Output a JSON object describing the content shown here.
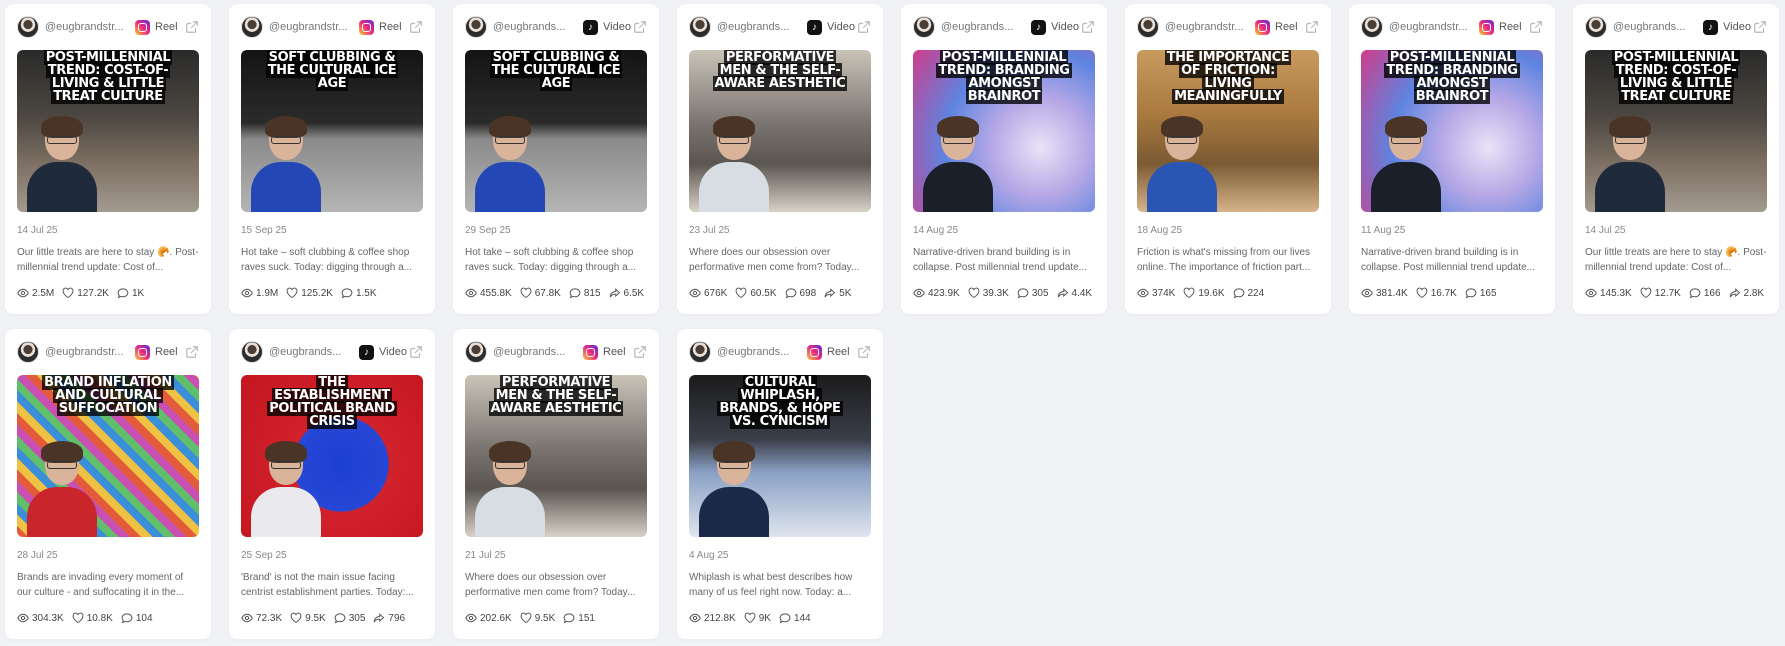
{
  "posts": [
    {
      "handle": "@eugbrandstr...",
      "platform": "instagram",
      "platform_label": "Reel",
      "title": "Post-Millennial Trend: Cost-of-Living & Little Treat Culture",
      "date": "14 Jul 25",
      "caption": "Our little treats are here to stay 🥐. Post-millennial trend update: Cost of...",
      "views": "2.5M",
      "likes": "127.2K",
      "comments": "1K",
      "shares": "",
      "bg": "linear-gradient(180deg,#2a2a2a 0%,#4b4640 40%,#7d6f63 70%,#a39a90 100%)",
      "shirt": "#1f2a3b"
    },
    {
      "handle": "@eugbrandstr...",
      "platform": "instagram",
      "platform_label": "Reel",
      "title": "Soft Clubbing & The Cultural Ice Age",
      "date": "15 Sep 25",
      "caption": "Hot take – soft clubbing & coffee shop raves suck. Today: digging through a...",
      "views": "1.9M",
      "likes": "125.2K",
      "comments": "1.5K",
      "shares": "",
      "bg": "linear-gradient(180deg,#141414 0%,#2b2b2b 45%,#8a8a8a 55%,#b5b5b5 100%)",
      "shirt": "#2447b8"
    },
    {
      "handle": "@eugbrands...",
      "platform": "tiktok",
      "platform_label": "Video",
      "title": "Soft Clubbing & The Cultural Ice Age",
      "date": "29 Sep 25",
      "caption": "Hot take – soft clubbing & coffee shop raves suck. Today: digging through a...",
      "views": "455.8K",
      "likes": "67.8K",
      "comments": "815",
      "shares": "6.5K",
      "bg": "linear-gradient(180deg,#141414 0%,#2b2b2b 45%,#8a8a8a 55%,#b5b5b5 100%)",
      "shirt": "#2447b8"
    },
    {
      "handle": "@eugbrands...",
      "platform": "tiktok",
      "platform_label": "Video",
      "title": "Performative Men & The Self-Aware Aesthetic",
      "date": "23 Jul 25",
      "caption": "Where does our obsession over performative men come from? Today...",
      "views": "676K",
      "likes": "60.5K",
      "comments": "698",
      "shares": "5K",
      "bg": "linear-gradient(180deg,#c9c3b8 0%,#7a7570 45%,#5a5550 70%,#d8d2c8 100%)",
      "shirt": "#d7dde3"
    },
    {
      "handle": "@eugbrands...",
      "platform": "tiktok",
      "platform_label": "Video",
      "title": "Post-Millennial Trend: Branding Amongst Brainrot",
      "date": "14 Aug 25",
      "caption": "Narrative-driven brand building is in collapse. Post millennial trend update...",
      "views": "423.9K",
      "likes": "39.3K",
      "comments": "305",
      "shares": "4.4K",
      "bg": "radial-gradient(circle at 70% 60%,#e8e4f7 0%,#b7a8e6 30%,#5e84e0 60%,#d13b8a 100%)",
      "shirt": "#1b1f2a"
    },
    {
      "handle": "@eugbrandstr...",
      "platform": "instagram",
      "platform_label": "Reel",
      "title": "The Importance of Friction: Living Meaningfully",
      "date": "18 Aug 25",
      "caption": "Friction is what's missing from our lives online. The importance of friction part...",
      "views": "374K",
      "likes": "19.6K",
      "comments": "224",
      "shares": "",
      "bg": "linear-gradient(180deg,#c99a5e 0%,#a9793f 40%,#7b5a33 70%,#d6b48a 100%)",
      "shirt": "#2a55b5"
    },
    {
      "handle": "@eugbrandstr...",
      "platform": "instagram",
      "platform_label": "Reel",
      "title": "Post-Millennial Trend: Branding Amongst Brainrot",
      "date": "11 Aug 25",
      "caption": "Narrative-driven brand building is in collapse. Post millennial trend update...",
      "views": "381.4K",
      "likes": "16.7K",
      "comments": "165",
      "shares": "",
      "bg": "radial-gradient(circle at 70% 60%,#e8e4f7 0%,#b7a8e6 30%,#5e84e0 60%,#d13b8a 100%)",
      "shirt": "#1b1f2a"
    },
    {
      "handle": "@eugbrands...",
      "platform": "tiktok",
      "platform_label": "Video",
      "title": "Post-Millennial Trend: Cost-of-Living & Little Treat Culture",
      "date": "14 Jul 25",
      "caption": "Our little treats are here to stay 🥐. Post-millennial trend update: Cost of...",
      "views": "145.3K",
      "likes": "12.7K",
      "comments": "166",
      "shares": "2.8K",
      "bg": "linear-gradient(180deg,#2a2a2a 0%,#4b4640 40%,#7d6f63 70%,#a39a90 100%)",
      "shirt": "#1f2a3b"
    },
    {
      "handle": "@eugbrandstr...",
      "platform": "instagram",
      "platform_label": "Reel",
      "title": "Brand Inflation and Cultural Suffocation",
      "date": "28 Jul 25",
      "caption": "Brands are invading every moment of our culture - and suffocating it in the...",
      "views": "304.3K",
      "likes": "10.8K",
      "comments": "104",
      "shares": "",
      "bg": "repeating-linear-gradient(45deg,#e45b3c 0 8px,#f0c243 8px 16px,#3a8fd8 16px 24px,#5fbf6a 24px 32px,#c94fb3 32px 40px)",
      "shirt": "#c9262b"
    },
    {
      "handle": "@eugbrands...",
      "platform": "tiktok",
      "platform_label": "Video",
      "title": "The Establishment Political Brand Crisis",
      "date": "25 Sep 25",
      "caption": "'Brand' is not the main issue facing centrist establishment parties. Today:...",
      "views": "72.3K",
      "likes": "9.5K",
      "comments": "305",
      "shares": "796",
      "bg": "radial-gradient(circle at 55% 55%,#1d3fd0 0%,#2647d6 35%,#d1222b 36%,#c4161f 100%)",
      "shirt": "#e9e9ee"
    },
    {
      "handle": "@eugbrands...",
      "platform": "instagram",
      "platform_label": "Reel",
      "title": "Performative Men & The Self-Aware Aesthetic",
      "date": "21 Jul 25",
      "caption": "Where does our obsession over performative men come from? Today...",
      "views": "202.6K",
      "likes": "9.5K",
      "comments": "151",
      "shares": "",
      "bg": "linear-gradient(180deg,#c9c3b8 0%,#7a7570 45%,#5a5550 70%,#d8d2c8 100%)",
      "shirt": "#d7dde3"
    },
    {
      "handle": "@eugbrands...",
      "platform": "instagram",
      "platform_label": "Reel",
      "title": "Cultural Whiplash, Brands, & Hope vs. Cynicism",
      "date": "4 Aug 25",
      "caption": "Whiplash is what best describes how many of us feel right now. Today: a...",
      "views": "212.8K",
      "likes": "9K",
      "comments": "144",
      "shares": "",
      "bg": "linear-gradient(180deg,#1b1b1b 0%,#3b3f4a 40%,#8aa0c4 60%,#dfe5ee 100%)",
      "shirt": "#1a2a48"
    }
  ]
}
